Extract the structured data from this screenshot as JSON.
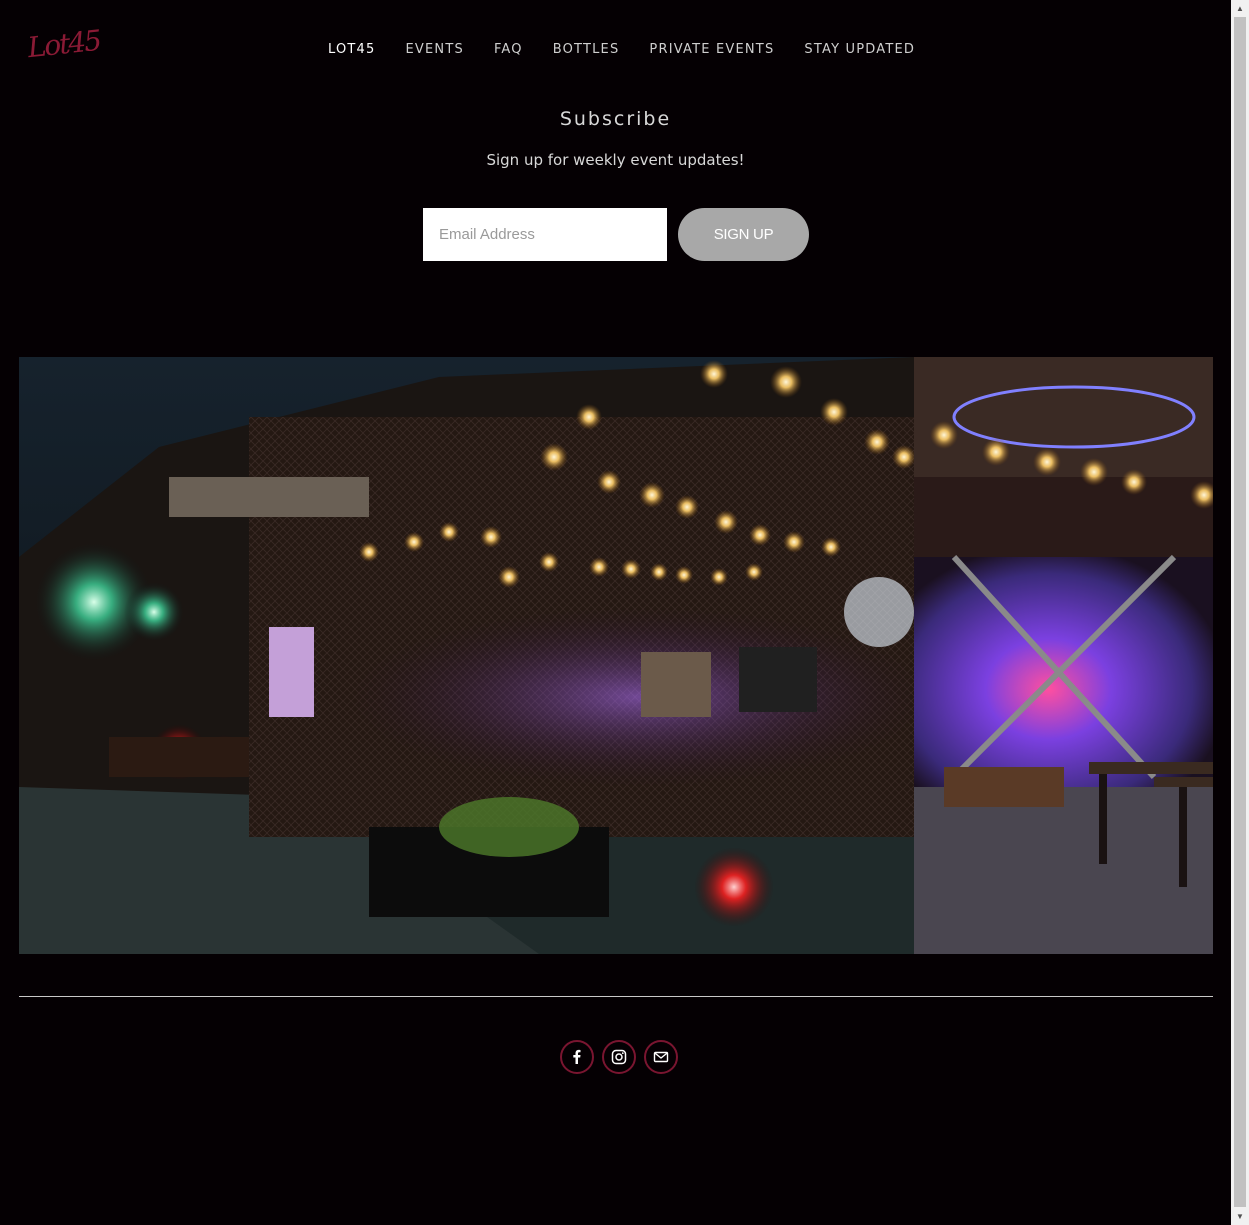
{
  "logo": {
    "text": "Lot45"
  },
  "nav": {
    "items": [
      {
        "label": "LOT45"
      },
      {
        "label": "EVENTS"
      },
      {
        "label": "FAQ"
      },
      {
        "label": "BOTTLES"
      },
      {
        "label": "PRIVATE EVENTS"
      },
      {
        "label": "STAY UPDATED"
      }
    ]
  },
  "subscribe": {
    "title": "Subscribe",
    "description": "Sign up for weekly event updates!",
    "email_placeholder": "Email Address",
    "button_label": "SIGN UP"
  },
  "gallery": {
    "images": [
      {
        "icon": "outdoor-patio-night-photo"
      },
      {
        "icon": "indoor-purple-lit-brick-wall-photo"
      }
    ]
  },
  "social": {
    "icons": [
      "facebook-icon",
      "instagram-icon",
      "email-icon"
    ],
    "accent": "#7a1530"
  }
}
